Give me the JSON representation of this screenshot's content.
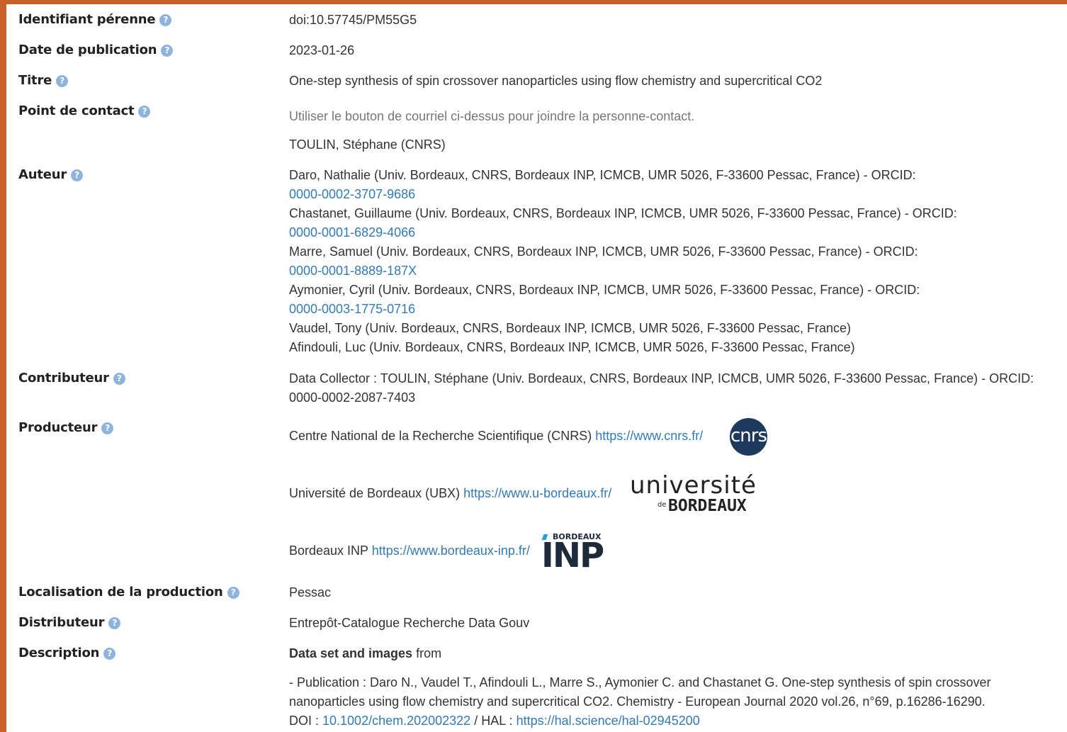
{
  "fields": {
    "identifier": {
      "label": "Identifiant pérenne",
      "value": "doi:10.57745/PM55G5"
    },
    "pubdate": {
      "label": "Date de publication",
      "value": "2023-01-26"
    },
    "title": {
      "label": "Titre",
      "value": "One-step synthesis of spin crossover nanoparticles using flow chemistry and supercritical CO2"
    },
    "contact": {
      "label": "Point de contact",
      "note": "Utiliser le bouton de courriel ci-dessus pour joindre la personne-contact.",
      "value": "TOULIN, Stéphane (CNRS)"
    },
    "authors": {
      "label": "Auteur",
      "items": [
        {
          "name": "Daro, Nathalie (Univ. Bordeaux, CNRS, Bordeaux INP, ICMCB, UMR 5026, F-33600 Pessac, France) - ORCID:",
          "orcid": "0000-0002-3707-9686"
        },
        {
          "name": "Chastanet, Guillaume (Univ. Bordeaux, CNRS, Bordeaux INP, ICMCB, UMR 5026, F-33600 Pessac, France) - ORCID:",
          "orcid": "0000-0001-6829-4066"
        },
        {
          "name": "Marre, Samuel (Univ. Bordeaux, CNRS, Bordeaux INP, ICMCB, UMR 5026, F-33600 Pessac, France) - ORCID:",
          "orcid": "0000-0001-8889-187X"
        },
        {
          "name": "Aymonier, Cyril (Univ. Bordeaux, CNRS, Bordeaux INP, ICMCB, UMR 5026, F-33600 Pessac, France) - ORCID:",
          "orcid": "0000-0003-1775-0716"
        },
        {
          "name": "Vaudel, Tony (Univ. Bordeaux, CNRS, Bordeaux INP, ICMCB, UMR 5026, F-33600 Pessac, France)"
        },
        {
          "name": "Afindouli, Luc (Univ. Bordeaux, CNRS, Bordeaux INP, ICMCB, UMR 5026, F-33600 Pessac, France)"
        }
      ]
    },
    "contributor": {
      "label": "Contributeur",
      "line1": "Data Collector : TOULIN, Stéphane (Univ. Bordeaux, CNRS, Bordeaux INP, ICMCB, UMR 5026, F-33600 Pessac, France) - ORCID:",
      "line2": "0000-0002-2087-7403"
    },
    "producer": {
      "label": "Producteur",
      "items": [
        {
          "name": "Centre National de la Recherche Scientifique (CNRS)",
          "url": "https://www.cnrs.fr/",
          "logo": "cnrs"
        },
        {
          "name": "Université de Bordeaux (UBX)",
          "url": "https://www.u-bordeaux.fr/",
          "logo_top": "université",
          "logo_de": "de",
          "logo_bottom": "BORDEAUX"
        },
        {
          "name": "Bordeaux INP",
          "url": "https://www.bordeaux-inp.fr/",
          "logo_top": "BORDEAUX",
          "logo_bottom": "INP"
        }
      ]
    },
    "location": {
      "label": "Localisation de la production",
      "value": "Pessac"
    },
    "distributor": {
      "label": "Distributeur",
      "value": "Entrepôt-Catalogue Recherche Data Gouv"
    },
    "description": {
      "label": "Description",
      "bold": "Data set and images",
      "rest": " from",
      "line1": "- Publication : Daro N., Vaudel T., Afindouli L., Marre S., Aymonier C. and Chastanet G. One-step synthesis of spin crossover",
      "line2": "nanoparticles using flow chemistry and supercritical CO2. Chemistry - European Journal 2020 vol.26, n°69, p.16286-16290.",
      "doi_prefix": "DOI : ",
      "doi": "10.1002/chem.202002322",
      "hal_prefix": " / HAL : ",
      "hal": "https://hal.science/hal-02945200"
    }
  },
  "help_glyph": "?",
  "colors": {
    "accent_border": "#c8602a",
    "link": "#337ab7",
    "help_icon": "#8fb4db",
    "cnrs_logo": "#1d3a5c",
    "inp_logo": "#2a9fd6"
  }
}
